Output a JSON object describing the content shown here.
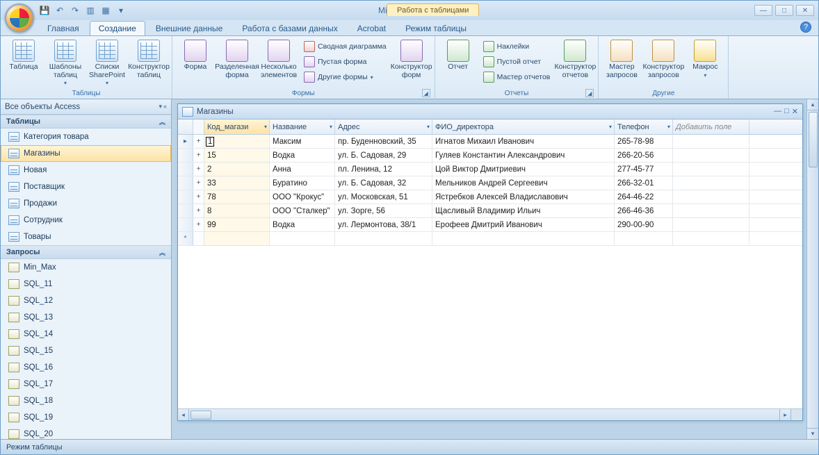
{
  "app_title": "Microsoft Access",
  "context_tab": "Работа с таблицами",
  "tabs": {
    "home": "Главная",
    "create": "Создание",
    "ext": "Внешние данные",
    "db": "Работа с базами данных",
    "acrobat": "Acrobat",
    "datasheet": "Режим таблицы"
  },
  "ribbon": {
    "groups": {
      "tables": "Таблицы",
      "forms": "Формы",
      "reports": "Отчеты",
      "other": "Другие"
    },
    "btn": {
      "table": "Таблица",
      "tpl": "Шаблоны таблиц",
      "sp": "Списки SharePoint",
      "tdesign": "Конструктор таблиц",
      "form": "Форма",
      "split": "Разделенная форма",
      "multi": "Несколько элементов",
      "pivchart": "Сводная диаграмма",
      "blank": "Пустая форма",
      "moreforms": "Другие формы",
      "fdesign": "Конструктор форм",
      "report": "Отчет",
      "labels": "Наклейки",
      "blankrep": "Пустой отчет",
      "repwiz": "Мастер отчетов",
      "rdesign": "Конструктор отчетов",
      "qwiz": "Мастер запросов",
      "qdesign": "Конструктор запросов",
      "macro": "Макрос"
    }
  },
  "nav": {
    "header": "Все объекты Access",
    "groups": {
      "tables": "Таблицы",
      "queries": "Запросы"
    },
    "tables": [
      "Категория товара",
      "Магазины",
      "Новая",
      "Поставщик",
      "Продажи",
      "Сотрудник",
      "Товары"
    ],
    "queries": [
      "Min_Max",
      "SQL_11",
      "SQL_12",
      "SQL_13",
      "SQL_14",
      "SQL_15",
      "SQL_16",
      "SQL_17",
      "SQL_18",
      "SQL_19",
      "SQL_20"
    ]
  },
  "subwindow": {
    "title": "Магазины"
  },
  "columns": {
    "code": "Код_магази",
    "name": "Название",
    "addr": "Адрес",
    "dir": "ФИО_директора",
    "tel": "Телефон",
    "add": "Добавить поле"
  },
  "rows": [
    {
      "code": "1",
      "name": "Максим",
      "addr": "пр. Буденновский, 35",
      "dir": "Игнатов Михаил Иванович",
      "tel": "265-78-98"
    },
    {
      "code": "15",
      "name": "Водка",
      "addr": "ул. Б. Садовая, 29",
      "dir": "Гуляев Константин Александрович",
      "tel": "266-20-56"
    },
    {
      "code": "2",
      "name": "Анна",
      "addr": "пл. Ленина, 12",
      "dir": "Цой Виктор Дмитриевич",
      "tel": "277-45-77"
    },
    {
      "code": "33",
      "name": "Буратино",
      "addr": "ул. Б. Садовая, 32",
      "dir": "Мельников Андрей Сергеевич",
      "tel": "266-32-01"
    },
    {
      "code": "78",
      "name": "ООО \"Крокус\"",
      "addr": "ул. Московская, 51",
      "dir": "Ястребков Алексей Владиславович",
      "tel": "264-46-22"
    },
    {
      "code": "8",
      "name": "ООО \"Сталкер\"",
      "addr": "ул. Зорге, 56",
      "dir": "Щасливый Владимир Ильич",
      "tel": "266-46-36"
    },
    {
      "code": "99",
      "name": "Водка",
      "addr": "ул. Лермонтова, 38/1",
      "dir": "Ерофеев Дмитрий Иванович",
      "tel": "290-00-90"
    }
  ],
  "statusbar": "Режим таблицы"
}
